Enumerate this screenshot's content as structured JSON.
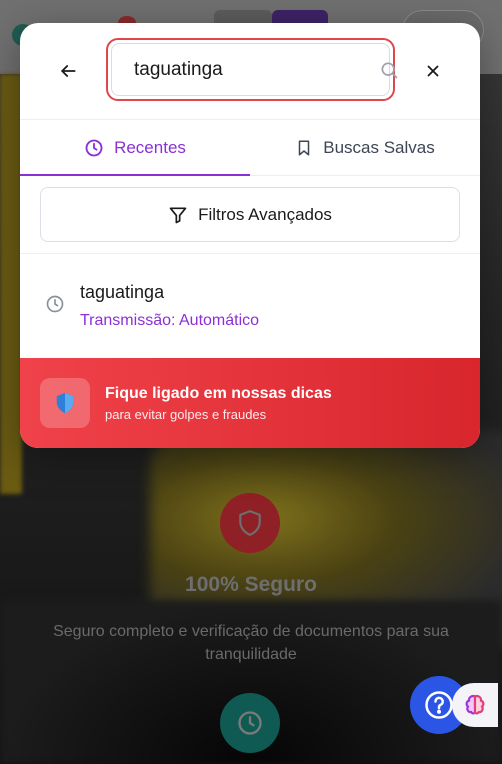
{
  "search": {
    "value": "taguatinga",
    "placeholder": ""
  },
  "tabs": [
    {
      "label": "Recentes",
      "icon": "clock-icon",
      "active": true
    },
    {
      "label": "Buscas Salvas",
      "icon": "bookmark-icon",
      "active": false
    }
  ],
  "filters": {
    "label": "Filtros Avançados",
    "icon": "filter-icon"
  },
  "recent": [
    {
      "title": "taguatinga",
      "subtitle": "Transmissão: Automático",
      "icon": "history-clock-icon"
    }
  ],
  "tips_banner": {
    "title": "Fique ligado em nossas dicas",
    "subtitle": "para evitar golpes e fraudes",
    "icon": "shield-icon"
  },
  "background": {
    "heading": "100% Seguro",
    "description": "Seguro completo e verificação de documentos para sua tranquilidade"
  },
  "colors": {
    "accent_purple": "#8b2fd6",
    "banner_red": "#e53238",
    "help_blue": "#2b56e5",
    "search_outline": "#e0474d"
  }
}
